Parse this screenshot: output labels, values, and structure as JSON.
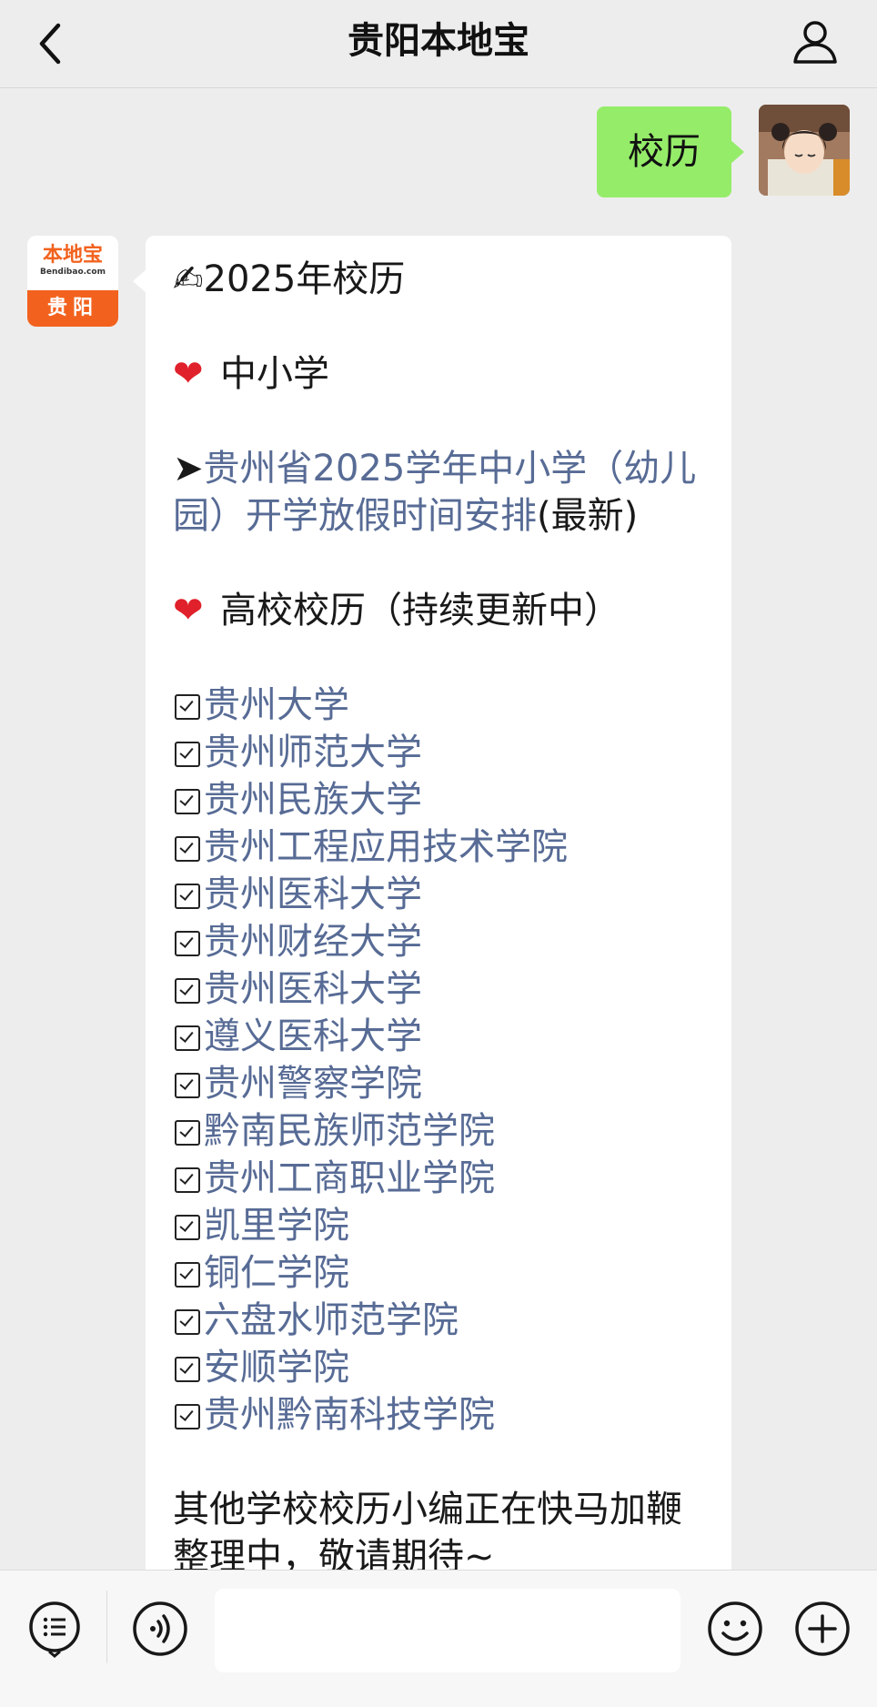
{
  "nav": {
    "title": "贵阳本地宝",
    "back_icon": "chevron-left-icon",
    "user_icon": "user-icon"
  },
  "self_message": {
    "text": "校历"
  },
  "bot": {
    "avatar": {
      "logo_text": "本地宝",
      "logo_sub": "Bendibao.com",
      "city": "贵阳"
    },
    "title": "✍2025年校历",
    "section_k12": "中小学",
    "k12_link_prefix": "➤",
    "k12_link": "贵州省2025学年中小学（幼儿园）开学放假时间安排",
    "k12_suffix": "(最新)",
    "section_college": "高校校历（持续更新中）",
    "colleges": [
      "贵州大学",
      "贵州师范大学",
      "贵州民族大学",
      "贵州工程应用技术学院",
      "贵州医科大学",
      "贵州财经大学",
      "贵州医科大学",
      "遵义医科大学",
      "贵州警察学院",
      "黔南民族师范学院",
      "贵州工商职业学院",
      "凯里学院",
      "铜仁学院",
      "六盘水师范学院",
      "安顺学院",
      "贵州黔南科技学院"
    ],
    "footer_text": "其他学校校历小编正在快马加鞭整理中，敬请期待~"
  },
  "input_bar": {
    "menu_icon": "menu-list-icon",
    "voice_icon": "voice-icon",
    "emoji_icon": "emoji-icon",
    "plus_icon": "plus-icon",
    "input_value": ""
  },
  "colors": {
    "background": "#ededed",
    "self_bubble": "#95ec69",
    "link": "#576b95",
    "brand_orange": "#f2621e",
    "heart": "#e0202a"
  }
}
